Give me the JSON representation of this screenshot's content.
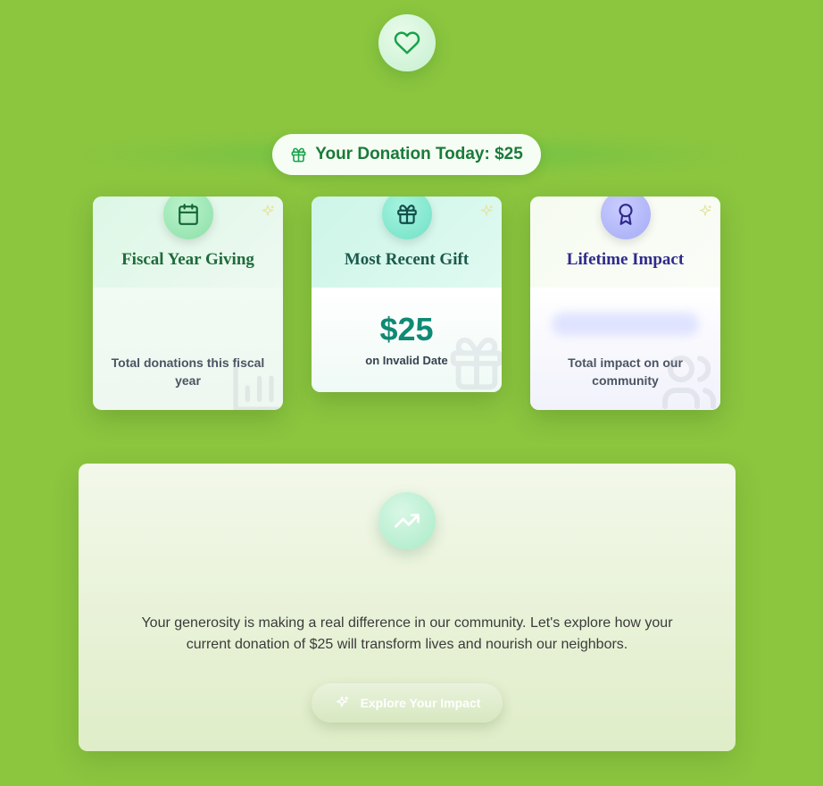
{
  "header": {
    "icon": "heart-icon",
    "donation_label": "Your Donation Today: $25"
  },
  "cards": [
    {
      "title": "Fiscal Year Giving",
      "icon": "calendar-icon",
      "description": "Total donations this fiscal year"
    },
    {
      "title": "Most Recent Gift",
      "icon": "gift-icon",
      "amount": "$25",
      "date": "on Invalid Date"
    },
    {
      "title": "Lifetime Impact",
      "icon": "award-icon",
      "description": "Total impact on our community"
    }
  ],
  "impact": {
    "icon": "trending-up-icon",
    "message": "Your generosity is making a real difference in our community. Let's explore how your current donation of $25 will transform lives and nourish our neighbors.",
    "button_label": "Explore Your Impact"
  },
  "colors": {
    "background": "#8cc63f",
    "accent_green": "#1a7a3a",
    "teal": "#0f8a74",
    "indigo": "#2e2a8c"
  }
}
